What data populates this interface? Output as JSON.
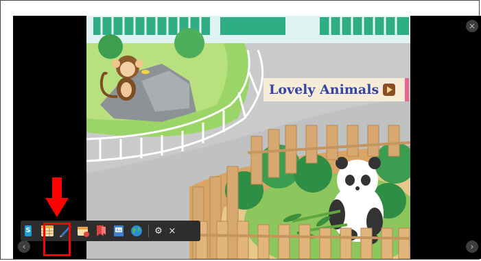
{
  "banner": {
    "title": "Lovely Animals"
  },
  "window": {
    "close_glyph": "×",
    "prev_glyph": "‹",
    "next_glyph": "›"
  },
  "toolbar": {
    "items": [
      {
        "name": "s-app-icon",
        "label": "S"
      },
      {
        "name": "table-icon"
      },
      {
        "name": "pen-icon"
      },
      {
        "name": "calendar-icon"
      },
      {
        "name": "bookmark-icon"
      },
      {
        "name": "dictionary-icon",
        "label": "Aa"
      },
      {
        "name": "globe-icon"
      }
    ],
    "gear_glyph": "⚙",
    "close_glyph": "×"
  },
  "colors": {
    "highlight": "#ff0000",
    "toolbar_bg": "#2d2d2d",
    "banner_title": "#3346a3"
  }
}
